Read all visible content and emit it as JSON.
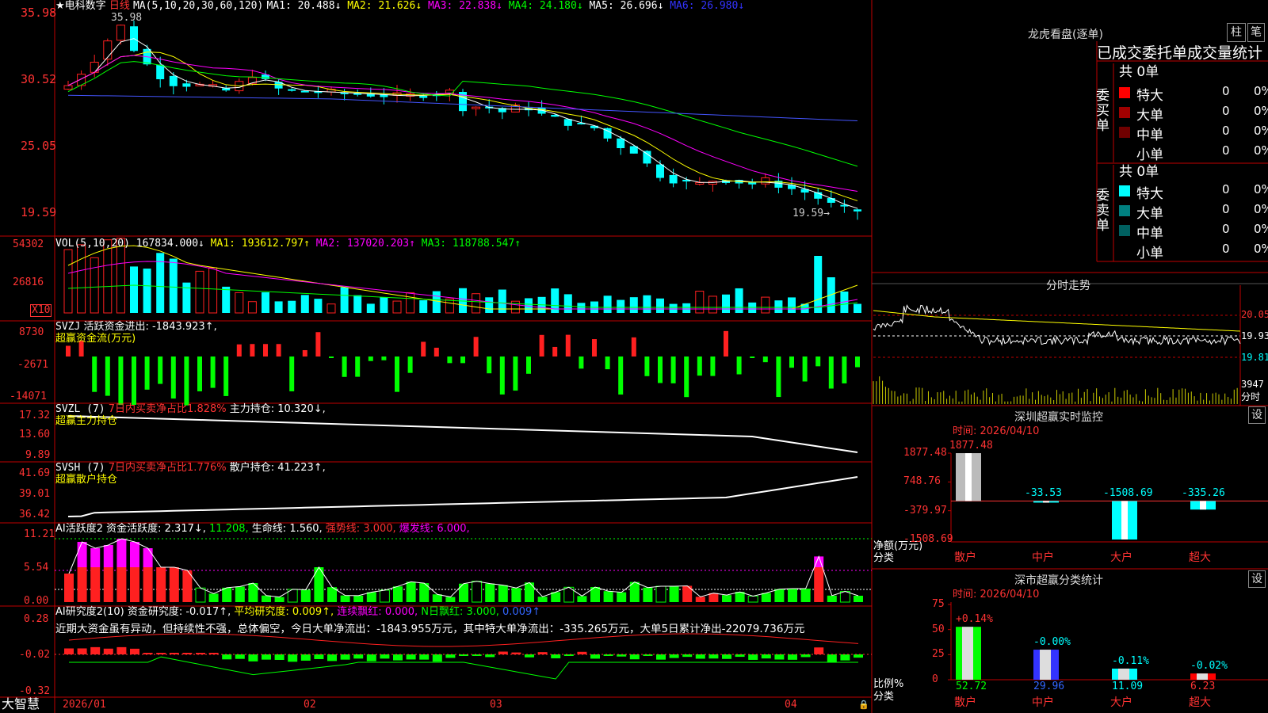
{
  "stock": {
    "star": "★",
    "name": "电科数字",
    "period": "日线"
  },
  "ma_info": {
    "label": "MA(5,10,20,30,60,120)",
    "items": [
      {
        "text": "MA1: 20.488↓",
        "color": "#ffffff"
      },
      {
        "text": "MA2: 21.626↓",
        "color": "#ffff00"
      },
      {
        "text": "MA3: 22.838↓",
        "color": "#ff00ff"
      },
      {
        "text": "MA4: 24.180↓",
        "color": "#00ff00"
      },
      {
        "text": "MA5: 26.696↓",
        "color": "#ffffff"
      },
      {
        "text": "MA6: 26.980↓",
        "color": "#3333ff"
      }
    ],
    "high_label": "35.98",
    "low_label": "19.59→"
  },
  "price_axis": [
    "35.98",
    "30.52",
    "25.05",
    "19.59"
  ],
  "vol": {
    "label": "VOL(5,10,20)",
    "value": "167834.000↓",
    "items": [
      {
        "text": "MA1: 193612.797↑",
        "color": "#ffff00"
      },
      {
        "text": "MA2: 137020.203↑",
        "color": "#ff00ff"
      },
      {
        "text": "MA3: 118788.547↑",
        "color": "#00ff00"
      }
    ],
    "axis": [
      "54302",
      "26816"
    ],
    "unit": "X10"
  },
  "svzj": {
    "label": "SVZJ",
    "title": "活跃资金进出: -1843.923↑,",
    "subtitle": "超赢资金流(万元)",
    "axis": [
      "8730",
      "-2671",
      "-14071"
    ]
  },
  "svzl": {
    "label": "SVZL (7)",
    "ratio": "7日内买卖净占比1.828%",
    "hold": "主力持仓: 10.320↓,",
    "subtitle": "超赢主力持仓",
    "axis": [
      "17.32",
      "13.60",
      "9.89"
    ]
  },
  "svsh": {
    "label": "SVSH (7)",
    "ratio": "7日内买卖净占比1.776%",
    "hold": "散户持仓: 41.223↑,",
    "subtitle": "超赢散户持仓",
    "axis": [
      "41.69",
      "39.01",
      "36.42"
    ]
  },
  "ai1": {
    "label": "AI活跃度2",
    "items": [
      {
        "text": "资金活跃度: 2.317↓,",
        "color": "#ffffff"
      },
      {
        "text": "11.208,",
        "color": "#00ff00"
      },
      {
        "text": "生命线: 1.560,",
        "color": "#ffffff"
      },
      {
        "text": "强势线: 3.000,",
        "color": "#ff3333"
      },
      {
        "text": "爆发线: 6.000,",
        "color": "#ff00ff"
      }
    ],
    "axis": [
      "11.21",
      "5.54",
      "0.00"
    ]
  },
  "ai2": {
    "label": "AI研究度2(10)",
    "items": [
      {
        "text": "资金研究度: -0.017↑,",
        "color": "#ffffff"
      },
      {
        "text": "平均研究度: 0.009↑,",
        "color": "#ffff00"
      },
      {
        "text": "连续飘红: 0.000,",
        "color": "#ff00ff"
      },
      {
        "text": "N日飘红: 3.000,",
        "color": "#00ff00"
      },
      {
        "text": "0.009↑",
        "color": "#3366ff"
      }
    ],
    "comment": "近期大资金虽有异动，但持续性不强，总体偏空，今日大单净流出：-1843.955万元，其中特大单净流出：-335.265万元，大单5日累计净出-22079.736万元",
    "axis": [
      "0.28",
      "-0.02",
      "-0.32"
    ]
  },
  "date_axis": [
    "2026/01",
    "02",
    "03",
    "04"
  ],
  "brand": "大智慧",
  "lhb": {
    "title": "龙虎看盘(逐单)",
    "btn_bar": "柱",
    "btn_pen": "笔",
    "tabs": "已成交委托单成交量统计",
    "buy": {
      "side": "委买单",
      "total": "共 0单",
      "rows": [
        {
          "name": "特大",
          "val": "0",
          "pct": "0%",
          "color": "#ff0000"
        },
        {
          "name": "大单",
          "val": "0",
          "pct": "0%",
          "color": "#a00000"
        },
        {
          "name": "中单",
          "val": "0",
          "pct": "0%",
          "color": "#700000"
        },
        {
          "name": "小单",
          "val": "0",
          "pct": "0%",
          "color": ""
        }
      ]
    },
    "sell": {
      "side": "委卖单",
      "total": "共 0单",
      "rows": [
        {
          "name": "特大",
          "val": "0",
          "pct": "0%",
          "color": "#00ffff"
        },
        {
          "name": "大单",
          "val": "0",
          "pct": "0%",
          "color": "#008080"
        },
        {
          "name": "中单",
          "val": "0",
          "pct": "0%",
          "color": "#006060"
        },
        {
          "name": "小单",
          "val": "0",
          "pct": "0%",
          "color": ""
        }
      ]
    }
  },
  "intraday": {
    "title": "分时走势",
    "axis": [
      "20.05",
      "19.93",
      "19.81"
    ],
    "vol_value": "3947",
    "vol_unit": "分时"
  },
  "sz_monitor": {
    "title": "深圳超赢实时监控",
    "btn": "设",
    "time": "时间: 2026/04/10",
    "axis": [
      "1877.48",
      "748.76",
      "-379.97",
      "-1508.69"
    ],
    "unit": "净额(万元)",
    "unit2": "分类",
    "bars": [
      {
        "cat": "散户",
        "value": 1877.48,
        "label": "1877.48"
      },
      {
        "cat": "中户",
        "value": -33.53,
        "label": "-33.53"
      },
      {
        "cat": "大户",
        "value": -1508.69,
        "label": "-1508.69"
      },
      {
        "cat": "超大",
        "value": -335.26,
        "label": "-335.26"
      }
    ]
  },
  "sz_class": {
    "title": "深市超赢分类统计",
    "btn": "设",
    "time": "时间: 2026/04/10",
    "axis": [
      "75",
      "50",
      "25",
      "0"
    ],
    "unit": "比例%",
    "unit2": "分类",
    "bars": [
      {
        "cat": "散户",
        "value": 52.72,
        "label": "52.72",
        "delta": "+0.14%",
        "color": "#00ff00"
      },
      {
        "cat": "中户",
        "value": 29.96,
        "label": "29.96",
        "delta": "-0.00%",
        "color": "#3333ff"
      },
      {
        "cat": "大户",
        "value": 11.09,
        "label": "11.09",
        "delta": "-0.11%",
        "color": "#00ffff"
      },
      {
        "cat": "超大",
        "value": 6.23,
        "label": "6.23",
        "delta": "-0.02%",
        "color": "#ff0000"
      }
    ]
  },
  "colors": {
    "up": "#ff2020",
    "down": "#00ffff",
    "grid": "#c00000",
    "axis_text": "#ff3333"
  }
}
